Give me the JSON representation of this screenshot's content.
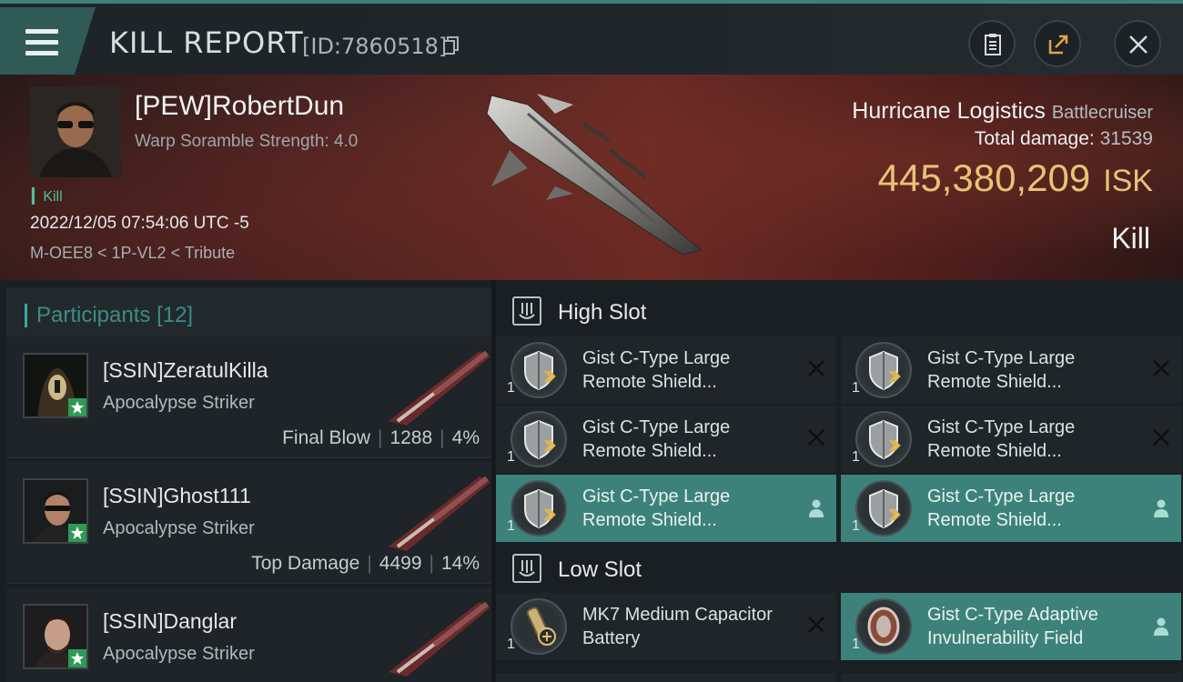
{
  "header": {
    "title": "KILL REPORT",
    "report_id": "[ID:7860518]",
    "icons": [
      "menu-icon",
      "copy-icon",
      "clipboard-icon",
      "share-icon",
      "close-icon"
    ]
  },
  "victim": {
    "name": "[PEW]RobertDun",
    "scramble": "Warp Soramble Strength: 4.0",
    "tag": "Kill",
    "timestamp": "2022/12/05 07:54:06 UTC -5",
    "location": "M-OEE8 < 1P-VL2 < Tribute"
  },
  "ship": {
    "name": "Hurricane Logistics",
    "class": "Battlecruiser",
    "total_damage_label": "Total damage:",
    "total_damage": "31539",
    "value": "445,380,209",
    "unit": "ISK",
    "result": "Kill"
  },
  "participants": {
    "label": "Participants",
    "count": "[12]",
    "items": [
      {
        "name": "[SSIN]ZeratulKilla",
        "ship": "Apocalypse Striker",
        "role": "Final Blow",
        "damage": "1288",
        "pct": "4%"
      },
      {
        "name": "[SSIN]Ghost111",
        "ship": "Apocalypse Striker",
        "role": "Top Damage",
        "damage": "4499",
        "pct": "14%"
      },
      {
        "name": "[SSIN]Danglar",
        "ship": "Apocalypse Striker"
      }
    ]
  },
  "slots": {
    "high": {
      "label": "High Slot",
      "modules": [
        {
          "name": "Gist C-Type Large Remote Shield...",
          "qty": "1",
          "status": "destroyed"
        },
        {
          "name": "Gist C-Type Large Remote Shield...",
          "qty": "1",
          "status": "destroyed"
        },
        {
          "name": "Gist C-Type Large Remote Shield...",
          "qty": "1",
          "status": "dropped"
        },
        {
          "name": "Gist C-Type Large Remote Shield...",
          "qty": "1",
          "status": "destroyed"
        },
        {
          "name": "Gist C-Type Large Remote Shield...",
          "qty": "1",
          "status": "destroyed"
        },
        {
          "name": "Gist C-Type Large Remote Shield...",
          "qty": "1",
          "status": "dropped"
        }
      ]
    },
    "low": {
      "label": "Low Slot",
      "modules": [
        {
          "name": "MK7 Medium Capacitor Battery",
          "qty": "1",
          "status": "destroyed"
        },
        {
          "name": "Gist C-Type Adaptive Invulnerability Field",
          "qty": "1",
          "status": "dropped"
        }
      ]
    }
  },
  "colors": {
    "accent": "#3d827a",
    "isk_gold": "#e7c374",
    "kill_green": "#4fbf9b"
  }
}
